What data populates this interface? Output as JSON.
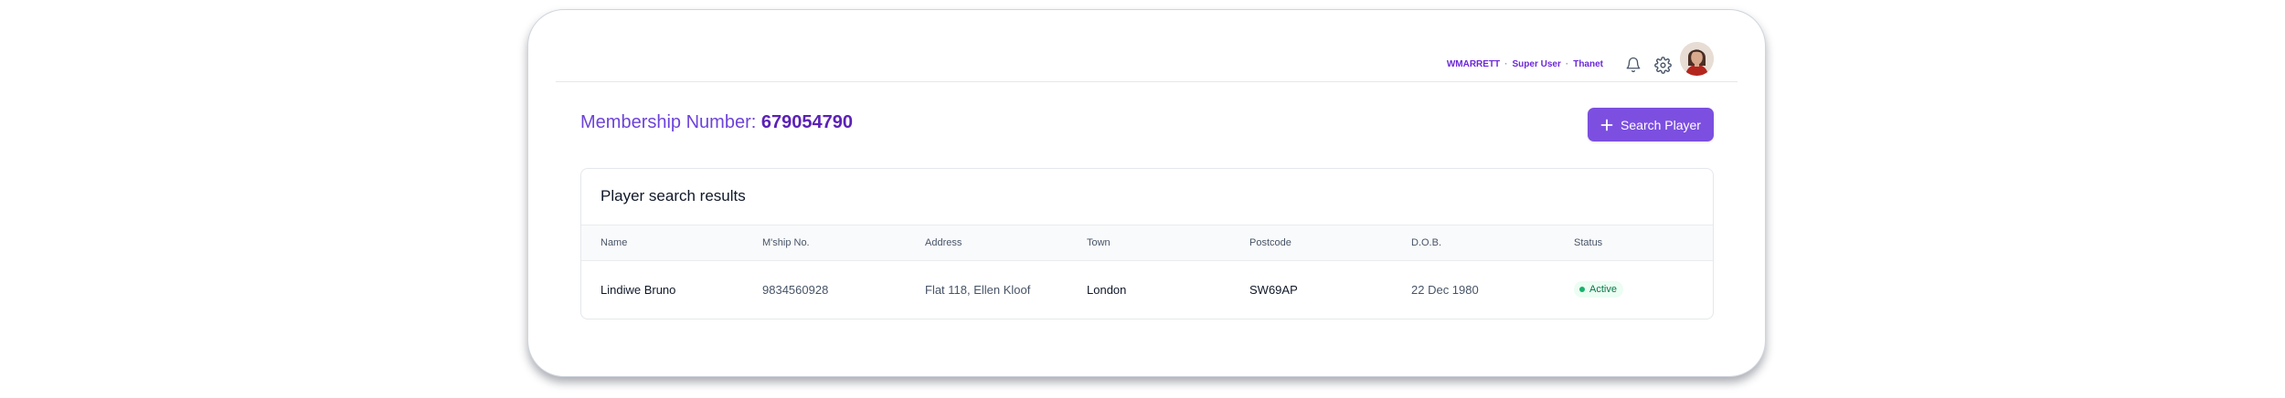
{
  "header": {
    "username": "WMARRETT",
    "role": "Super User",
    "location": "Thanet",
    "separator": "·"
  },
  "page": {
    "title_prefix": "Membership Number:",
    "membership_number": "679054790"
  },
  "actions": {
    "search_player_label": "Search Player"
  },
  "results": {
    "title": "Player search results",
    "columns": [
      "Name",
      "M'ship No.",
      "Address",
      "Town",
      "Postcode",
      "D.O.B.",
      "Status"
    ],
    "rows": [
      {
        "name": "Lindiwe Bruno",
        "membership_no": "9834560928",
        "address": "Flat 118, Ellen Kloof",
        "town": "London",
        "postcode": "SW69AP",
        "dob": "22 Dec 1980",
        "status": "Active"
      }
    ]
  },
  "colors": {
    "accent": "#7c4fe0",
    "title_purple": "#6d43d9",
    "status_active": "#17b26a"
  },
  "icons": [
    "bell-icon",
    "gear-icon",
    "plus-icon",
    "status-dot-icon"
  ]
}
